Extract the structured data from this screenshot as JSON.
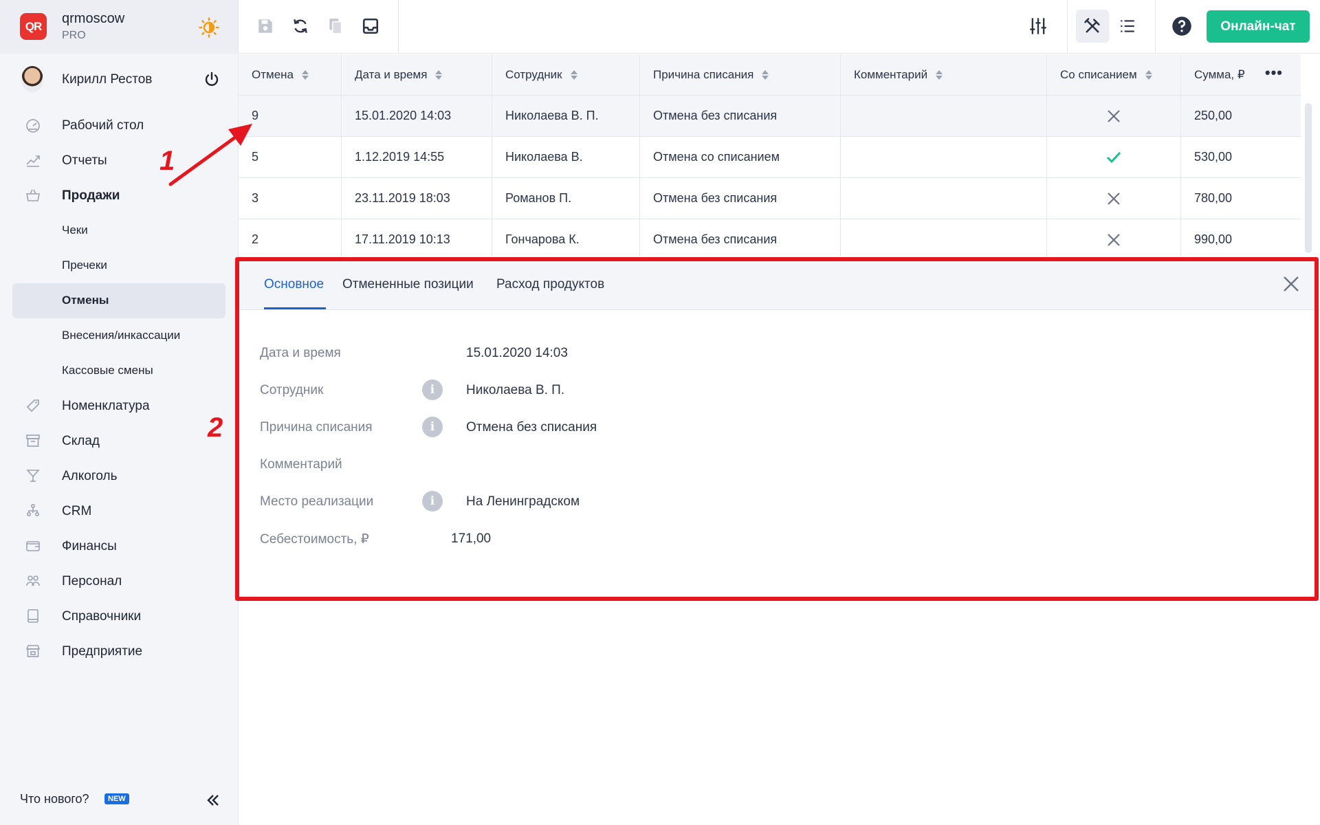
{
  "brand": {
    "logo_text": "QR",
    "name": "qrmoscow",
    "plan": "PRO"
  },
  "user": {
    "name": "Кирилл Рестов"
  },
  "nav": {
    "items": [
      {
        "label": "Рабочий стол",
        "icon": "dashboard-icon"
      },
      {
        "label": "Отчеты",
        "icon": "chart-icon"
      },
      {
        "label": "Продажи",
        "icon": "basket-icon"
      }
    ],
    "sales_sub": [
      {
        "label": "Чеки"
      },
      {
        "label": "Пречеки"
      },
      {
        "label": "Отмены"
      },
      {
        "label": "Внесения/инкассации"
      },
      {
        "label": "Кассовые смены"
      }
    ],
    "items2": [
      {
        "label": "Номенклатура",
        "icon": "tag-icon"
      },
      {
        "label": "Склад",
        "icon": "box-icon"
      },
      {
        "label": "Алкоголь",
        "icon": "glass-icon"
      },
      {
        "label": "CRM",
        "icon": "crm-icon"
      },
      {
        "label": "Финансы",
        "icon": "wallet-icon"
      },
      {
        "label": "Персонал",
        "icon": "people-icon"
      },
      {
        "label": "Справочники",
        "icon": "book-icon"
      },
      {
        "label": "Предприятие",
        "icon": "store-icon"
      }
    ],
    "whats_new": "Что нового?",
    "new_badge": "NEW"
  },
  "toolbar": {
    "chat_label": "Онлайн-чат"
  },
  "table": {
    "headers": [
      "Отмена",
      "Дата и время",
      "Сотрудник",
      "Причина списания",
      "Комментарий",
      "Со списанием",
      "Сумма, ₽"
    ],
    "rows": [
      {
        "id": "9",
        "datetime": "15.01.2020 14:03",
        "employee": "Николаева В. П.",
        "reason": "Отмена без списания",
        "comment": "",
        "writeoff": false,
        "sum": "250,00"
      },
      {
        "id": "5",
        "datetime": "1.12.2019 14:55",
        "employee": "Николаева В.",
        "reason": "Отмена со списанием",
        "comment": "",
        "writeoff": true,
        "sum": "530,00"
      },
      {
        "id": "3",
        "datetime": "23.11.2019 18:03",
        "employee": "Романов П.",
        "reason": "Отмена без списания",
        "comment": "",
        "writeoff": false,
        "sum": "780,00"
      },
      {
        "id": "2",
        "datetime": "17.11.2019 10:13",
        "employee": "Гончарова К.",
        "reason": "Отмена без списания",
        "comment": "",
        "writeoff": false,
        "sum": "990,00"
      }
    ]
  },
  "detail": {
    "tabs": [
      "Основное",
      "Отмененные позиции",
      "Расход продуктов"
    ],
    "fields": [
      {
        "label": "Дата и время",
        "value": "15.01.2020 14:03"
      },
      {
        "label": "Сотрудник",
        "value": "Николаева В. П."
      },
      {
        "label": "Причина списания",
        "value": "Отмена без списания"
      },
      {
        "label": "Комментарий",
        "value": ""
      },
      {
        "label": "Место реализации",
        "value": "На Ленинградском"
      },
      {
        "label": "Себестоимость, ₽",
        "value": "171,00"
      }
    ]
  },
  "annotations": {
    "one": "1",
    "two": "2"
  },
  "colors": {
    "accent_green": "#1bbf8d",
    "accent_blue": "#1a62d4",
    "annotation_red": "#e5161d",
    "check_green": "#1bbf8d"
  }
}
